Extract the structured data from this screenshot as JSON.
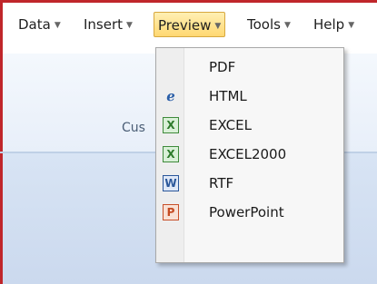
{
  "menubar": {
    "items": [
      {
        "label": "Data",
        "caret": "▼"
      },
      {
        "label": "Insert",
        "caret": "▼"
      },
      {
        "label": "Preview",
        "caret": "▼"
      },
      {
        "label": "Tools",
        "caret": "▼"
      },
      {
        "label": "Help",
        "caret": "▼"
      }
    ],
    "active_item": "Preview"
  },
  "ribbon": {
    "group_label_partial": "Cus"
  },
  "preview_menu": {
    "items": [
      {
        "label": "PDF",
        "icon": "none"
      },
      {
        "label": "HTML",
        "icon": "html-icon",
        "glyph": "ℯ"
      },
      {
        "label": "EXCEL",
        "icon": "excel-icon",
        "glyph": "X"
      },
      {
        "label": "EXCEL2000",
        "icon": "excel-icon",
        "glyph": "X"
      },
      {
        "label": "RTF",
        "icon": "word-icon",
        "glyph": "W"
      },
      {
        "label": "PowerPoint",
        "icon": "powerpoint-icon",
        "glyph": "P"
      }
    ]
  },
  "colors": {
    "frame_border": "#c0262b",
    "active_menu": "#ffd872",
    "excel": "#2d7a2a",
    "word": "#2b579a",
    "powerpoint": "#c44a22"
  }
}
